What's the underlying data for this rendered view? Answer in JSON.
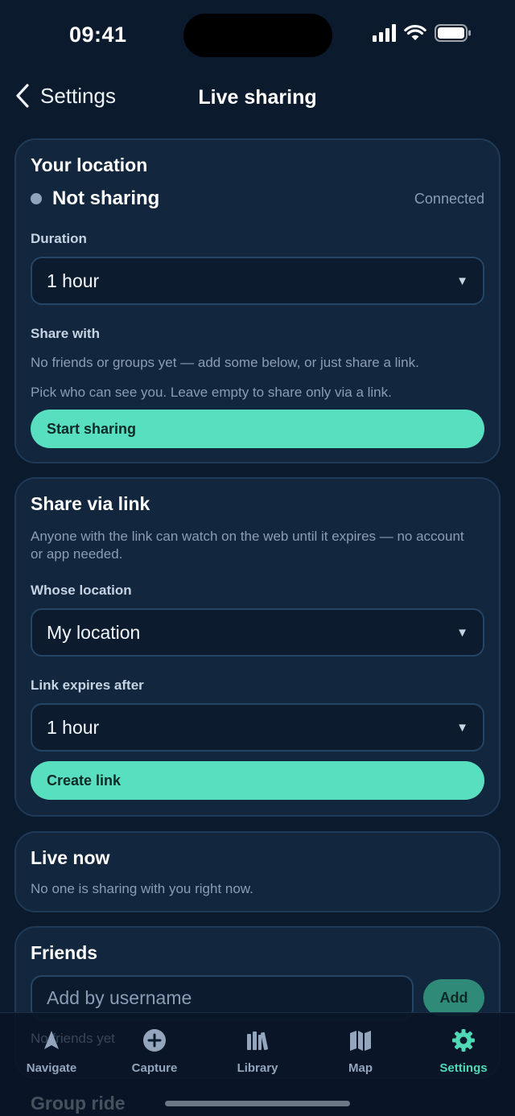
{
  "status_bar": {
    "time": "09:41"
  },
  "nav": {
    "back_label": "Settings",
    "title": "Live sharing"
  },
  "your_location": {
    "title": "Your location",
    "status": "Not sharing",
    "connection": "Connected",
    "duration_label": "Duration",
    "duration_value": "1 hour",
    "share_with_label": "Share with",
    "share_with_empty": "No friends or groups yet — add some below, or just share a link.",
    "share_with_hint": "Pick who can see you. Leave empty to share only via a link.",
    "start_button": "Start sharing"
  },
  "share_link": {
    "title": "Share via link",
    "description": "Anyone with the link can watch on the web until it expires — no account or app needed.",
    "whose_label": "Whose location",
    "whose_value": "My location",
    "expires_label": "Link expires after",
    "expires_value": "1 hour",
    "create_button": "Create link"
  },
  "live_now": {
    "title": "Live now",
    "empty": "No one is sharing with you right now."
  },
  "friends": {
    "title": "Friends",
    "input_placeholder": "Add by username",
    "add_button": "Add",
    "empty": "No friends yet"
  },
  "group_ride": {
    "title": "Group ride"
  },
  "tab_bar": {
    "tabs": [
      {
        "label": "Navigate",
        "icon": "navigate-arrow-icon"
      },
      {
        "label": "Capture",
        "icon": "plus-circle-icon"
      },
      {
        "label": "Library",
        "icon": "books-icon"
      },
      {
        "label": "Map",
        "icon": "map-icon"
      },
      {
        "label": "Settings",
        "icon": "gear-icon"
      }
    ],
    "active": "Settings"
  },
  "colors": {
    "background": "#0b1a2c",
    "card": "#12263d",
    "accent": "#58dfbf",
    "muted_text": "#8a9db4"
  }
}
